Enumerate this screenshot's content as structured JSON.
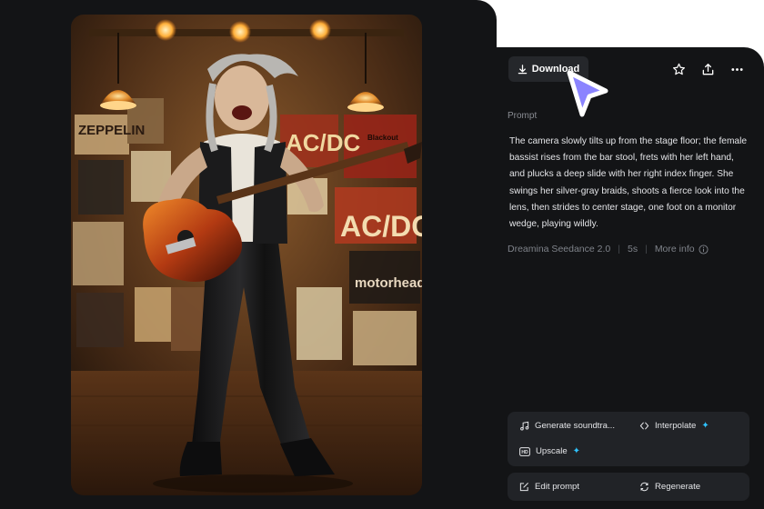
{
  "toolbar": {
    "download_label": "Download",
    "icons": [
      "download-icon",
      "star-icon",
      "share-icon",
      "more-icon"
    ]
  },
  "prompt": {
    "label": "Prompt",
    "text": "The camera slowly tilts up from the stage floor; the female bassist rises from the bar stool, frets with her left hand, and plucks a deep slide with her right index finger. She swings her silver-gray braids, shoots a fierce look into the lens, then strides to center stage, one foot on a monitor wedge, playing wildly."
  },
  "meta": {
    "model": "Dreamina Seedance 2.0",
    "duration": "5s",
    "more_info": "More info"
  },
  "tools": {
    "generate_soundtrack": "Generate soundtra...",
    "interpolate": "Interpolate",
    "upscale": "Upscale"
  },
  "actions": {
    "edit_prompt": "Edit prompt",
    "regenerate": "Regenerate"
  },
  "poster_words": [
    "ZEPPELIN",
    "AC/DC",
    "AC/DC",
    "motorhead",
    "Blackout"
  ],
  "colors": {
    "panel_bg": "#131416",
    "button_bg": "#25272b",
    "accent_sparkle": "#2fc3ff",
    "cursor_fill": "#8b84ff"
  }
}
